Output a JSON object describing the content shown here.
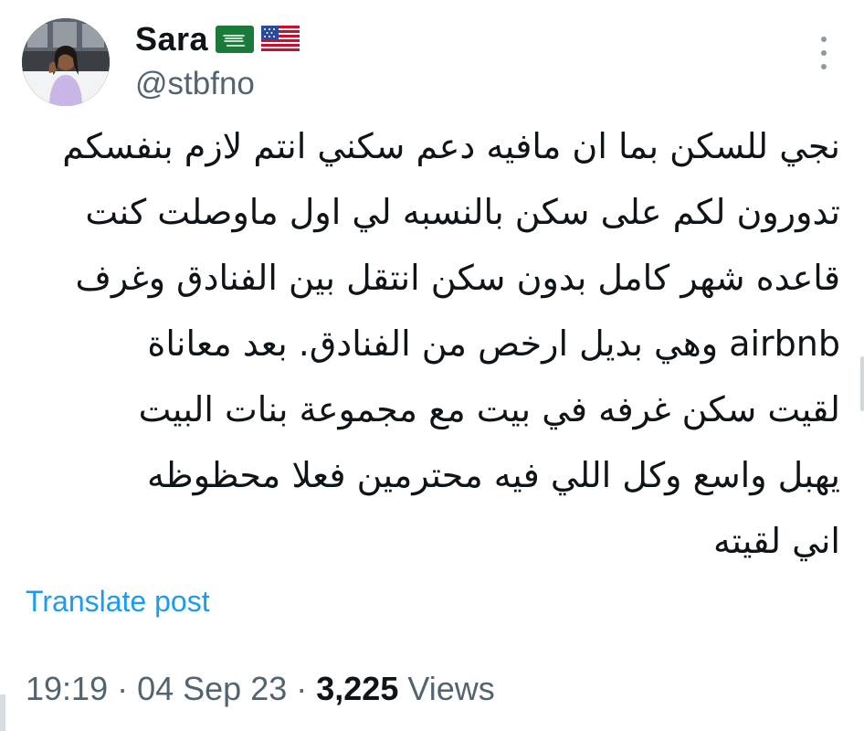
{
  "author": {
    "display_name": "Sara",
    "flags": [
      "saudi-arabia-flag",
      "united-states-flag"
    ],
    "handle": "@stbfno",
    "avatar": "profile-photo"
  },
  "tweet": {
    "lines": [
      "نجي للسكن بما ان مافيه دعم سكني انتم لازم بنفسكم",
      "تدورون لكم على سكن بالنسبه لي اول ماوصلت كنت",
      "قاعده شهر كامل بدون سكن انتقل بين الفنادق وغرف",
      "airbnb وهي بديل ارخص من الفنادق. بعد معاناة",
      "لقيت سكن غرفه في بيت مع مجموعة بنات البيت",
      "يهبل واسع وكل اللي فيه محترمين فعلا محظوظه",
      "اني لقيته"
    ],
    "translate_label": "Translate post"
  },
  "meta": {
    "time": "19:19",
    "separator1": " · ",
    "date": "04 Sep 23",
    "separator2": " · ",
    "views_count": "3,225",
    "views_label": " Views"
  },
  "colors": {
    "text": "#0f1419",
    "secondary": "#536471",
    "link": "#1d9bf0"
  },
  "icons": {
    "more": "more-vertical-icon"
  }
}
